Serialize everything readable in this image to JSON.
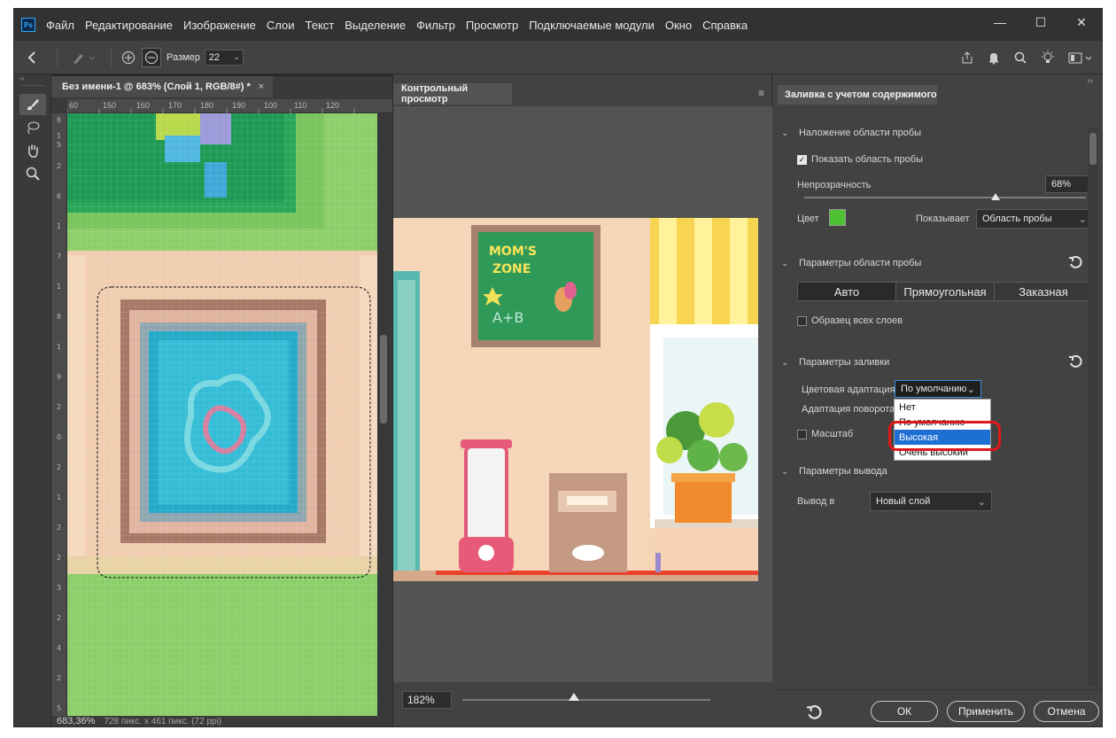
{
  "menubar": {
    "logo": "Ps",
    "items": [
      "Файл",
      "Редактирование",
      "Изображение",
      "Слои",
      "Текст",
      "Выделение",
      "Фильтр",
      "Просмотр",
      "Подключаемые модули",
      "Окно",
      "Справка"
    ],
    "window_controls": {
      "minimize": "—",
      "maximize": "☐",
      "close": "✕"
    }
  },
  "options_bar": {
    "size_label": "Размер",
    "size_value": "22"
  },
  "document": {
    "tab_title": "Без имени-1 @ 683% (Слой 1, RGB/8#) *",
    "tab_close": "×",
    "ruler_top": [
      "60",
      "150",
      "160",
      "170",
      "180",
      "190",
      "100",
      "110",
      "120"
    ],
    "status_zoom": "683,36%",
    "status_dims": "728 пикс. x 461 пикс. (72 ppi)"
  },
  "preview": {
    "tab_title": "Контрольный просмотр",
    "menu_icon": "≡",
    "zoom_value": "182%",
    "zoom_fraction": 0.45
  },
  "fill_panel": {
    "tab_title": "Заливка с учетом содержимого",
    "collapse": "››",
    "overlay_section": "Наложение области пробы",
    "show_sample_label": "Показать область пробы",
    "show_sample_checked": true,
    "opacity_label": "Непрозрачность",
    "opacity_value": "68%",
    "opacity_fraction": 0.68,
    "color_label": "Цвет",
    "color_value": "#4fc231",
    "shows_label": "Показывает",
    "shows_value": "Область пробы",
    "sample_section": "Параметры области пробы",
    "sample_modes": [
      "Авто",
      "Прямоугольная",
      "Заказная"
    ],
    "sample_mode_selected": 0,
    "all_layers_label": "Образец всех слоев",
    "fill_section": "Параметры заливки",
    "color_adapt_label": "Цветовая адаптация",
    "color_adapt_value": "По умолчанию",
    "color_adapt_options": [
      "Нет",
      "По умолчанию",
      "Высокая",
      "Очень высокий"
    ],
    "color_adapt_highlight": 2,
    "rotation_label": "Адаптация поворота",
    "scale_label": "Масштаб",
    "output_section": "Параметры вывода",
    "output_label": "Вывод в",
    "output_value": "Новый слой",
    "ok_label": "ОК",
    "apply_label": "Применить",
    "cancel_label": "Отмена"
  }
}
